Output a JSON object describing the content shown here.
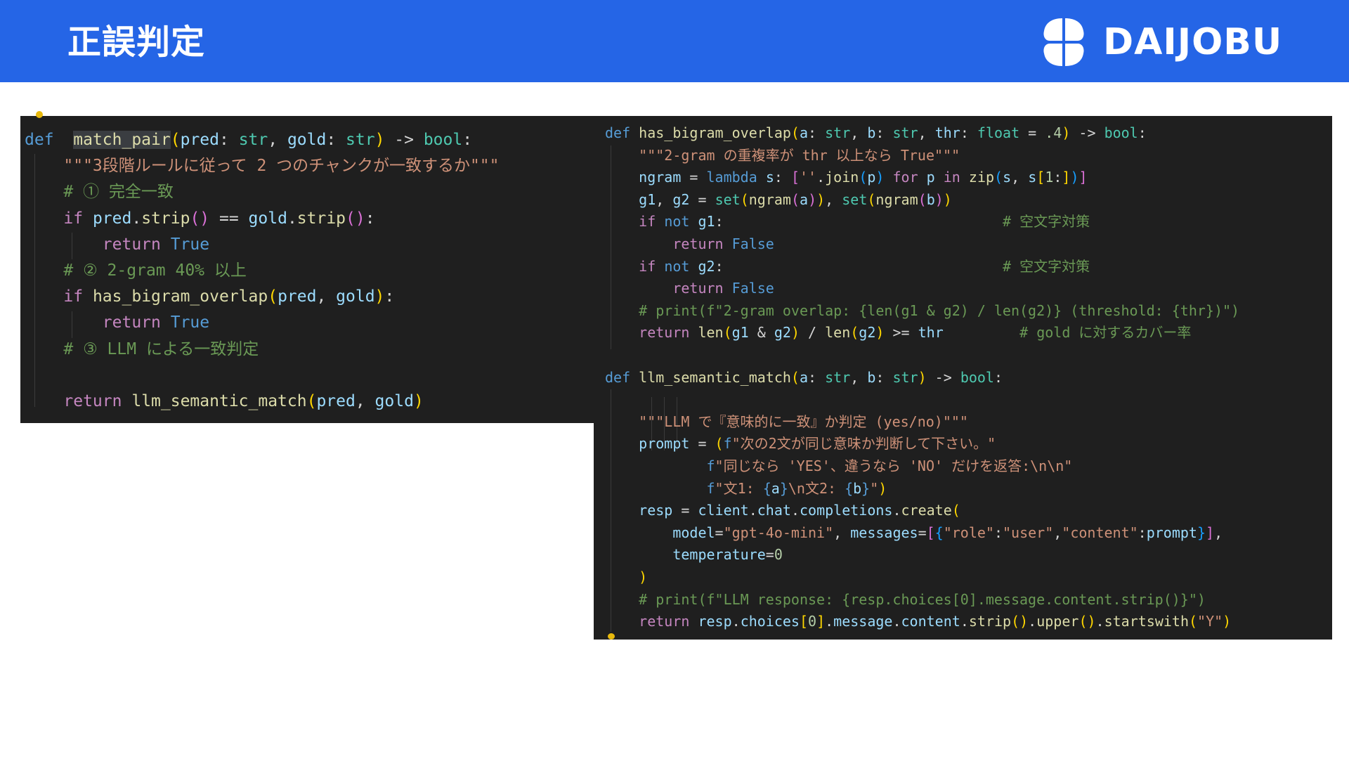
{
  "header": {
    "title": "正誤判定",
    "brand": "DAIJOBU",
    "brand_color": "#2565e6"
  },
  "code_left": {
    "lines": [
      {
        "segments": [
          [
            "kw",
            "def"
          ],
          [
            "",
            "  "
          ],
          [
            "fn hl",
            "match_pair"
          ],
          [
            "br",
            "("
          ],
          [
            "pa",
            "pred"
          ],
          [
            "",
            ": "
          ],
          [
            "ty",
            "str"
          ],
          [
            "",
            ", "
          ],
          [
            "pa",
            "gold"
          ],
          [
            "",
            ": "
          ],
          [
            "ty",
            "str"
          ],
          [
            "br",
            ")"
          ],
          [
            "",
            " -> "
          ],
          [
            "ty",
            "bool"
          ],
          [
            "",
            ":"
          ]
        ]
      },
      {
        "segments": [
          [
            "",
            "    "
          ],
          [
            "str",
            "\"\"\"3段階ルールに従って 2 つのチャンクが一致するか\"\"\""
          ]
        ]
      },
      {
        "segments": [
          [
            "",
            "    "
          ],
          [
            "cm",
            "# ① 完全一致"
          ]
        ]
      },
      {
        "segments": [
          [
            "",
            "    "
          ],
          [
            "ctl",
            "if"
          ],
          [
            "",
            " "
          ],
          [
            "pa",
            "pred"
          ],
          [
            "",
            "."
          ],
          [
            "fn",
            "strip"
          ],
          [
            "br2",
            "()"
          ],
          [
            "",
            " == "
          ],
          [
            "pa",
            "gold"
          ],
          [
            "",
            "."
          ],
          [
            "fn",
            "strip"
          ],
          [
            "br2",
            "()"
          ],
          [
            "",
            ":"
          ]
        ]
      },
      {
        "segments": [
          [
            "",
            "        "
          ],
          [
            "ctl",
            "return"
          ],
          [
            "",
            " "
          ],
          [
            "kw",
            "True"
          ]
        ]
      },
      {
        "segments": [
          [
            "",
            "    "
          ],
          [
            "cm",
            "# ② 2-gram 40% 以上"
          ]
        ]
      },
      {
        "segments": [
          [
            "",
            "    "
          ],
          [
            "ctl",
            "if"
          ],
          [
            "",
            " "
          ],
          [
            "fn",
            "has_bigram_overlap"
          ],
          [
            "br",
            "("
          ],
          [
            "pa",
            "pred"
          ],
          [
            "",
            ", "
          ],
          [
            "pa",
            "gold"
          ],
          [
            "br",
            ")"
          ],
          [
            "",
            ":"
          ]
        ]
      },
      {
        "segments": [
          [
            "",
            "        "
          ],
          [
            "ctl",
            "return"
          ],
          [
            "",
            " "
          ],
          [
            "kw",
            "True"
          ]
        ]
      },
      {
        "segments": [
          [
            "",
            "    "
          ],
          [
            "cm",
            "# ③ LLM による一致判定"
          ]
        ]
      },
      {
        "segments": [
          [
            "",
            ""
          ]
        ]
      },
      {
        "segments": [
          [
            "",
            "    "
          ],
          [
            "ctl",
            "return"
          ],
          [
            "",
            " "
          ],
          [
            "fn",
            "llm_semantic_match"
          ],
          [
            "br",
            "("
          ],
          [
            "pa",
            "pred"
          ],
          [
            "",
            ", "
          ],
          [
            "pa",
            "gold"
          ],
          [
            "br",
            ")"
          ]
        ]
      }
    ]
  },
  "code_right": {
    "lines": [
      {
        "segments": [
          [
            "kw",
            "def"
          ],
          [
            "",
            " "
          ],
          [
            "fn",
            "has_bigram_overlap"
          ],
          [
            "br",
            "("
          ],
          [
            "pa",
            "a"
          ],
          [
            "",
            ": "
          ],
          [
            "ty",
            "str"
          ],
          [
            "",
            ", "
          ],
          [
            "pa",
            "b"
          ],
          [
            "",
            ": "
          ],
          [
            "ty",
            "str"
          ],
          [
            "",
            ", "
          ],
          [
            "pa",
            "thr"
          ],
          [
            "",
            ": "
          ],
          [
            "ty",
            "float"
          ],
          [
            "",
            " = "
          ],
          [
            "num",
            ".4"
          ],
          [
            "br",
            ")"
          ],
          [
            "",
            " -> "
          ],
          [
            "ty",
            "bool"
          ],
          [
            "",
            ":"
          ]
        ]
      },
      {
        "segments": [
          [
            "",
            "    "
          ],
          [
            "str",
            "\"\"\"2-gram の重複率が thr 以上なら True\"\"\""
          ]
        ]
      },
      {
        "segments": [
          [
            "",
            "    "
          ],
          [
            "pa",
            "ngram"
          ],
          [
            "",
            " = "
          ],
          [
            "kw",
            "lambda"
          ],
          [
            "",
            " "
          ],
          [
            "pa",
            "s"
          ],
          [
            "",
            ": "
          ],
          [
            "br2",
            "["
          ],
          [
            "str",
            "''"
          ],
          [
            "",
            "."
          ],
          [
            "fn",
            "join"
          ],
          [
            "br3",
            "("
          ],
          [
            "pa",
            "p"
          ],
          [
            "br3",
            ")"
          ],
          [
            "",
            " "
          ],
          [
            "ctl",
            "for"
          ],
          [
            "",
            " "
          ],
          [
            "pa",
            "p"
          ],
          [
            "",
            " "
          ],
          [
            "ctl",
            "in"
          ],
          [
            "",
            " "
          ],
          [
            "fn",
            "zip"
          ],
          [
            "br3",
            "("
          ],
          [
            "pa",
            "s"
          ],
          [
            "",
            ", "
          ],
          [
            "pa",
            "s"
          ],
          [
            "br",
            "["
          ],
          [
            "num",
            "1"
          ],
          [
            "",
            ":"
          ],
          [
            "br",
            "]"
          ],
          [
            "br3",
            ")"
          ],
          [
            "br2",
            "]"
          ]
        ]
      },
      {
        "segments": [
          [
            "",
            "    "
          ],
          [
            "pa",
            "g1"
          ],
          [
            "",
            ", "
          ],
          [
            "pa",
            "g2"
          ],
          [
            "",
            " = "
          ],
          [
            "ty",
            "set"
          ],
          [
            "br",
            "("
          ],
          [
            "fn",
            "ngram"
          ],
          [
            "br2",
            "("
          ],
          [
            "pa",
            "a"
          ],
          [
            "br2",
            ")"
          ],
          [
            "br",
            ")"
          ],
          [
            "",
            ", "
          ],
          [
            "ty",
            "set"
          ],
          [
            "br",
            "("
          ],
          [
            "fn",
            "ngram"
          ],
          [
            "br2",
            "("
          ],
          [
            "pa",
            "b"
          ],
          [
            "br2",
            ")"
          ],
          [
            "br",
            ")"
          ]
        ]
      },
      {
        "segments": [
          [
            "",
            "    "
          ],
          [
            "ctl",
            "if"
          ],
          [
            "",
            " "
          ],
          [
            "kw",
            "not"
          ],
          [
            "",
            " "
          ],
          [
            "pa",
            "g1"
          ],
          [
            "",
            ":"
          ],
          [
            "",
            "                                 "
          ],
          [
            "cm",
            "# 空文字対策"
          ]
        ]
      },
      {
        "segments": [
          [
            "",
            "        "
          ],
          [
            "ctl",
            "return"
          ],
          [
            "",
            " "
          ],
          [
            "kw",
            "False"
          ]
        ]
      },
      {
        "segments": [
          [
            "",
            "    "
          ],
          [
            "ctl",
            "if"
          ],
          [
            "",
            " "
          ],
          [
            "kw",
            "not"
          ],
          [
            "",
            " "
          ],
          [
            "pa",
            "g2"
          ],
          [
            "",
            ":"
          ],
          [
            "",
            "                                 "
          ],
          [
            "cm",
            "# 空文字対策"
          ]
        ]
      },
      {
        "segments": [
          [
            "",
            "        "
          ],
          [
            "ctl",
            "return"
          ],
          [
            "",
            " "
          ],
          [
            "kw",
            "False"
          ]
        ]
      },
      {
        "segments": [
          [
            "",
            "    "
          ],
          [
            "cm",
            "# print(f\"2-gram overlap: {len(g1 & g2) / len(g2)} (threshold: {thr})\")"
          ]
        ]
      },
      {
        "segments": [
          [
            "",
            "    "
          ],
          [
            "ctl",
            "return"
          ],
          [
            "",
            " "
          ],
          [
            "fn",
            "len"
          ],
          [
            "br",
            "("
          ],
          [
            "pa",
            "g1"
          ],
          [
            "",
            " & "
          ],
          [
            "pa",
            "g2"
          ],
          [
            "br",
            ")"
          ],
          [
            "",
            " / "
          ],
          [
            "fn",
            "len"
          ],
          [
            "br",
            "("
          ],
          [
            "pa",
            "g2"
          ],
          [
            "br",
            ")"
          ],
          [
            "",
            " >= "
          ],
          [
            "pa",
            "thr"
          ],
          [
            "",
            "         "
          ],
          [
            "cm",
            "# gold に対するカバー率"
          ]
        ]
      },
      {
        "segments": [
          [
            "",
            ""
          ]
        ]
      },
      {
        "segments": [
          [
            "kw",
            "def"
          ],
          [
            "",
            " "
          ],
          [
            "fn",
            "llm_semantic_match"
          ],
          [
            "br",
            "("
          ],
          [
            "pa",
            "a"
          ],
          [
            "",
            ": "
          ],
          [
            "ty",
            "str"
          ],
          [
            "",
            ", "
          ],
          [
            "pa",
            "b"
          ],
          [
            "",
            ": "
          ],
          [
            "ty",
            "str"
          ],
          [
            "br",
            ")"
          ],
          [
            "",
            " -> "
          ],
          [
            "ty",
            "bool"
          ],
          [
            "",
            ":"
          ]
        ]
      },
      {
        "segments": [
          [
            "",
            ""
          ]
        ]
      },
      {
        "segments": [
          [
            "",
            "    "
          ],
          [
            "str",
            "\"\"\"LLM で『意味的に一致』か判定 (yes/no)\"\"\""
          ]
        ]
      },
      {
        "segments": [
          [
            "",
            "    "
          ],
          [
            "pa",
            "prompt"
          ],
          [
            "",
            " = "
          ],
          [
            "br",
            "("
          ],
          [
            "kw",
            "f"
          ],
          [
            "str",
            "\"次の2文が同じ意味か判断して下さい。\""
          ]
        ]
      },
      {
        "segments": [
          [
            "",
            "            "
          ],
          [
            "kw",
            "f"
          ],
          [
            "str",
            "\"同じなら 'YES'、違うなら 'NO' だけを返答:\\n\\n\""
          ]
        ]
      },
      {
        "segments": [
          [
            "",
            "            "
          ],
          [
            "kw",
            "f"
          ],
          [
            "str",
            "\"文1: "
          ],
          [
            "kw",
            "{"
          ],
          [
            "pa",
            "a"
          ],
          [
            "kw",
            "}"
          ],
          [
            "str",
            "\\n文2: "
          ],
          [
            "kw",
            "{"
          ],
          [
            "pa",
            "b"
          ],
          [
            "kw",
            "}"
          ],
          [
            "str",
            "\""
          ],
          [
            "br",
            ")"
          ]
        ]
      },
      {
        "segments": [
          [
            "",
            "    "
          ],
          [
            "pa",
            "resp"
          ],
          [
            "",
            " = "
          ],
          [
            "pa",
            "client"
          ],
          [
            "",
            "."
          ],
          [
            "pa",
            "chat"
          ],
          [
            "",
            "."
          ],
          [
            "pa",
            "completions"
          ],
          [
            "",
            "."
          ],
          [
            "fn",
            "create"
          ],
          [
            "br",
            "("
          ]
        ]
      },
      {
        "segments": [
          [
            "",
            "        "
          ],
          [
            "pa",
            "model"
          ],
          [
            "",
            "="
          ],
          [
            "str",
            "\"gpt-4o-mini\""
          ],
          [
            "",
            ", "
          ],
          [
            "pa",
            "messages"
          ],
          [
            "",
            "="
          ],
          [
            "br2",
            "["
          ],
          [
            "br3",
            "{"
          ],
          [
            "str",
            "\"role\""
          ],
          [
            "",
            ":"
          ],
          [
            "str",
            "\"user\""
          ],
          [
            "",
            ","
          ],
          [
            "str",
            "\"content\""
          ],
          [
            "",
            ":"
          ],
          [
            "pa",
            "prompt"
          ],
          [
            "br3",
            "}"
          ],
          [
            "br2",
            "]"
          ],
          [
            "",
            ","
          ]
        ]
      },
      {
        "segments": [
          [
            "",
            "        "
          ],
          [
            "pa",
            "temperature"
          ],
          [
            "",
            "="
          ],
          [
            "num",
            "0"
          ]
        ]
      },
      {
        "segments": [
          [
            "",
            "    "
          ],
          [
            "br",
            ")"
          ]
        ]
      },
      {
        "segments": [
          [
            "",
            "    "
          ],
          [
            "cm",
            "# print(f\"LLM response: {resp.choices[0].message.content.strip()}\")"
          ]
        ]
      },
      {
        "segments": [
          [
            "",
            "    "
          ],
          [
            "ctl",
            "return"
          ],
          [
            "",
            " "
          ],
          [
            "pa",
            "resp"
          ],
          [
            "",
            "."
          ],
          [
            "pa",
            "choices"
          ],
          [
            "br",
            "["
          ],
          [
            "num",
            "0"
          ],
          [
            "br",
            "]"
          ],
          [
            "",
            "."
          ],
          [
            "pa",
            "message"
          ],
          [
            "",
            "."
          ],
          [
            "pa",
            "content"
          ],
          [
            "",
            "."
          ],
          [
            "fn",
            "strip"
          ],
          [
            "br",
            "()"
          ],
          [
            "",
            "."
          ],
          [
            "fn",
            "upper"
          ],
          [
            "br",
            "()"
          ],
          [
            "",
            "."
          ],
          [
            "fn",
            "startswith"
          ],
          [
            "br",
            "("
          ],
          [
            "str",
            "\"Y\""
          ],
          [
            "br",
            ")"
          ]
        ]
      }
    ]
  }
}
